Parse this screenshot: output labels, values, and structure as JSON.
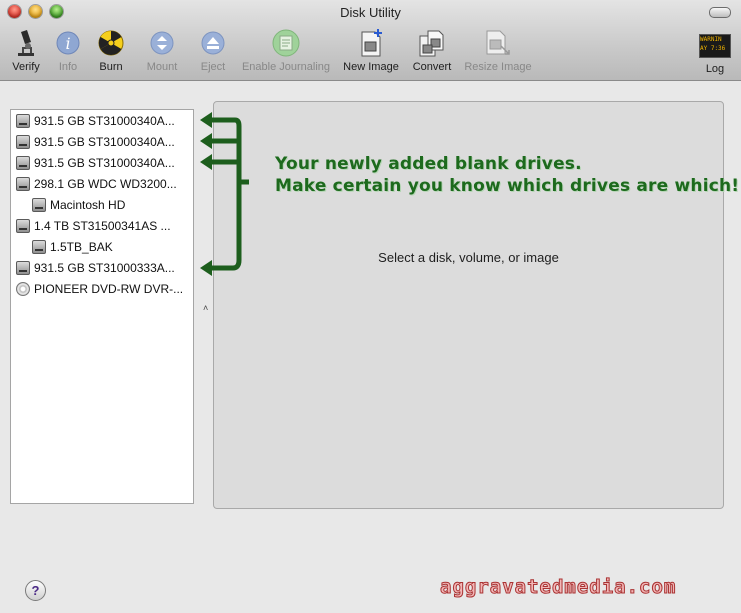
{
  "window": {
    "title": "Disk Utility"
  },
  "toolbar": {
    "items": [
      {
        "label": "Verify",
        "icon": "microscope-icon",
        "enabled": true
      },
      {
        "label": "Info",
        "icon": "info-icon",
        "enabled": false
      },
      {
        "label": "Burn",
        "icon": "burn-icon",
        "enabled": true
      },
      {
        "label": "Mount",
        "icon": "mount-icon",
        "enabled": false
      },
      {
        "label": "Eject",
        "icon": "eject-icon",
        "enabled": false
      },
      {
        "label": "Enable Journaling",
        "icon": "journaling-icon",
        "enabled": false
      },
      {
        "label": "New Image",
        "icon": "new-image-icon",
        "enabled": true
      },
      {
        "label": "Convert",
        "icon": "convert-icon",
        "enabled": true
      },
      {
        "label": "Resize Image",
        "icon": "resize-image-icon",
        "enabled": false
      },
      {
        "label": "Log",
        "icon": "log-icon",
        "enabled": true
      }
    ],
    "log_icon_text": [
      "WARNIN",
      "AY 7:36"
    ]
  },
  "sidebar": {
    "items": [
      {
        "label": "931.5 GB ST31000340A...",
        "kind": "disk"
      },
      {
        "label": "931.5 GB ST31000340A...",
        "kind": "disk"
      },
      {
        "label": "931.5 GB ST31000340A...",
        "kind": "disk"
      },
      {
        "label": "298.1 GB WDC WD3200...",
        "kind": "disk"
      },
      {
        "label": "Macintosh HD",
        "kind": "volume"
      },
      {
        "label": "1.4 TB ST31500341AS ...",
        "kind": "disk"
      },
      {
        "label": "1.5TB_BAK",
        "kind": "volume"
      },
      {
        "label": "931.5 GB ST31000333A...",
        "kind": "disk"
      },
      {
        "label": "PIONEER DVD-RW DVR-...",
        "kind": "optical"
      }
    ]
  },
  "main": {
    "message": "Select a disk, volume, or image"
  },
  "annotation": {
    "line1": "Your newly added blank drives.",
    "line2": "Make certain you know which drives are which!",
    "color": "#1d6a1d"
  },
  "footer": {
    "help_label": "?",
    "watermark": "aggravatedmedia.com"
  }
}
